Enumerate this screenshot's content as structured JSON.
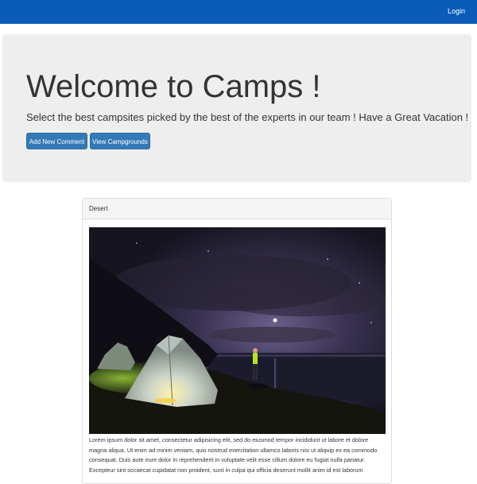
{
  "navbar": {
    "login_label": "Login",
    "color": "#0a5cb8"
  },
  "jumbotron": {
    "title": "Welcome to Camps !",
    "subtitle": "Select the best campsites picked by the best of the experts in our team ! Have a Great Vacation !",
    "buttons": [
      {
        "label": "Add New Comment"
      },
      {
        "label": "View Campgrounds"
      }
    ]
  },
  "campground": {
    "name": "Desert",
    "image_icon": "night-tent-photo",
    "description": "Lorem ipsum dolor sit amet, consectetur adipisicing elit, sed do eiusmod tempor incididunt ut labore et dolore magna aliqua. Ut enim ad minim veniam, quis nostrud exercitation ullamco laboris nisi ut aliquip ex ea commodo consequat. Duis aute irure dolor in reprehenderit in voluptate velit esse cillum dolore eu fugiat nulla pariatur. Excepteur sint occaecat cupidatat non proident, sunt in culpa qui officia deserunt mollit anim id est laborum"
  },
  "colors": {
    "primary_button": "#337ab7",
    "jumbotron_bg": "#eeeeee"
  }
}
